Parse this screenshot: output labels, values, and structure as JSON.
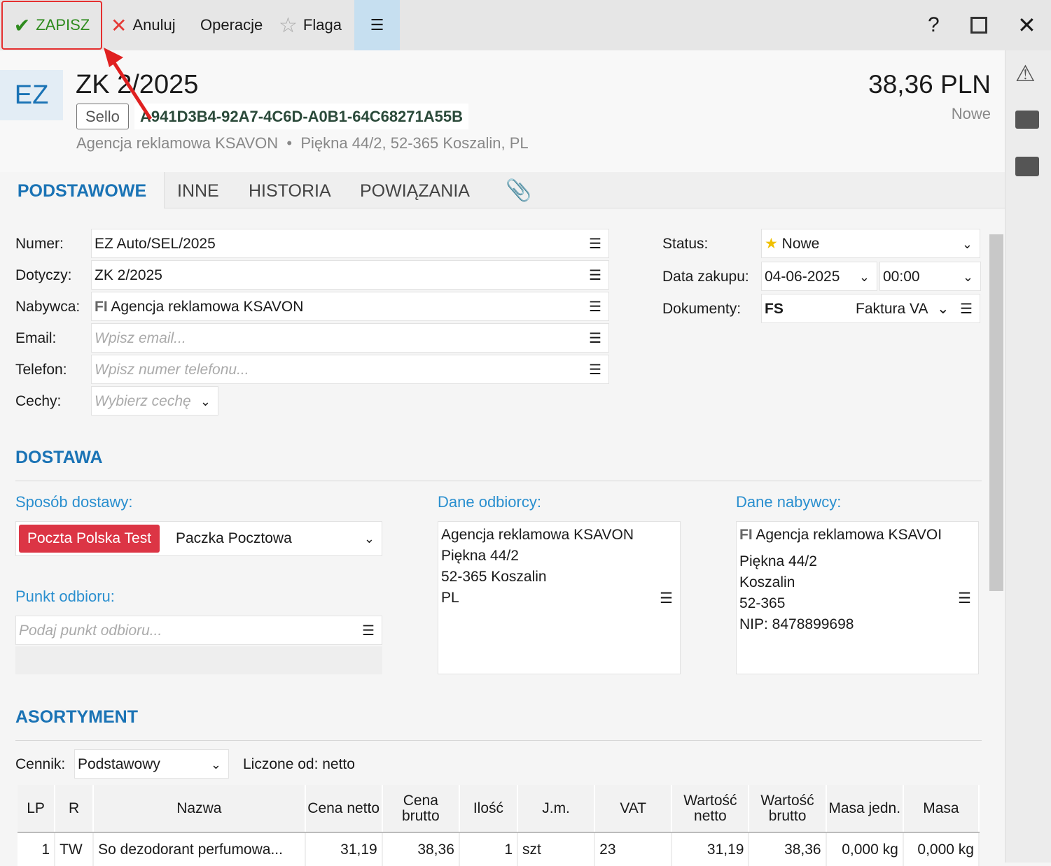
{
  "toolbar": {
    "save": "ZAPISZ",
    "cancel": "Anuluj",
    "operations": "Operacje",
    "flag": "Flaga",
    "help": "?"
  },
  "header": {
    "doc_type": "EZ",
    "title": "ZK 2/2025",
    "store": "Sello",
    "guid": "A941D3B4-92A7-4C6D-A0B1-64C68271A55B",
    "customer": "Agencja reklamowa KSAVON",
    "address": "Piękna  44/2, 52-365 Koszalin, PL",
    "amount": "38,36 PLN",
    "status": "Nowe"
  },
  "tabs": [
    "PODSTAWOWE",
    "INNE",
    "HISTORIA",
    "POWIĄZANIA"
  ],
  "form": {
    "numer_label": "Numer:",
    "numer": "EZ Auto/SEL/2025",
    "dotyczy_label": "Dotyczy:",
    "dotyczy": "ZK 2/2025",
    "nabywca_label": "Nabywca:",
    "nabywca_prefix": "FI",
    "nabywca": "Agencja reklamowa KSAVON",
    "email_label": "Email:",
    "email_placeholder": "Wpisz email...",
    "telefon_label": "Telefon:",
    "telefon_placeholder": "Wpisz numer telefonu...",
    "cechy_label": "Cechy:",
    "cechy_placeholder": "Wybierz cechę",
    "status_label": "Status:",
    "status": "Nowe",
    "data_label": "Data zakupu:",
    "date": "04-06-2025",
    "time": "00:00",
    "dok_label": "Dokumenty:",
    "dok_code": "FS",
    "dok_type": "Faktura VA"
  },
  "dostawa": {
    "title": "DOSTAWA",
    "sposob_label": "Sposób dostawy:",
    "carrier": "Poczta Polska Test",
    "service": "Paczka Pocztowa",
    "punkt_label": "Punkt odbioru:",
    "punkt_placeholder": "Podaj punkt odbioru...",
    "odbiorca_label": "Dane odbiorcy:",
    "odbiorca": [
      "Agencja reklamowa KSAVON",
      "Piękna  44/2",
      "52-365 Koszalin",
      "PL"
    ],
    "nabywca_label": "Dane nabywcy:",
    "nabywca_prefix": "FI",
    "nabywca": [
      "Agencja reklamowa KSAVOI",
      "Piękna  44/2",
      "Koszalin",
      "52-365",
      "NIP: 8478899698"
    ]
  },
  "asortyment": {
    "title": "ASORTYMENT",
    "cennik_label": "Cennik:",
    "cennik": "Podstawowy",
    "liczone": "Liczone od: netto",
    "columns": [
      "LP",
      "R",
      "Nazwa",
      "Cena netto",
      "Cena brutto",
      "Ilość",
      "J.m.",
      "VAT",
      "Wartość netto",
      "Wartość brutto",
      "Masa jedn.",
      "Masa"
    ],
    "rows": [
      [
        "1",
        "TW",
        "So dezodorant perfumowa...",
        "31,19",
        "38,36",
        "1",
        "szt",
        "23",
        "31,19",
        "38,36",
        "0,000 kg",
        "0,000 kg"
      ]
    ]
  },
  "colors": {
    "accent": "#1a73b5",
    "save": "#2e8b1e",
    "cancel": "#e53935",
    "carrier": "#dc3545",
    "highlight": "#c6dff0"
  }
}
